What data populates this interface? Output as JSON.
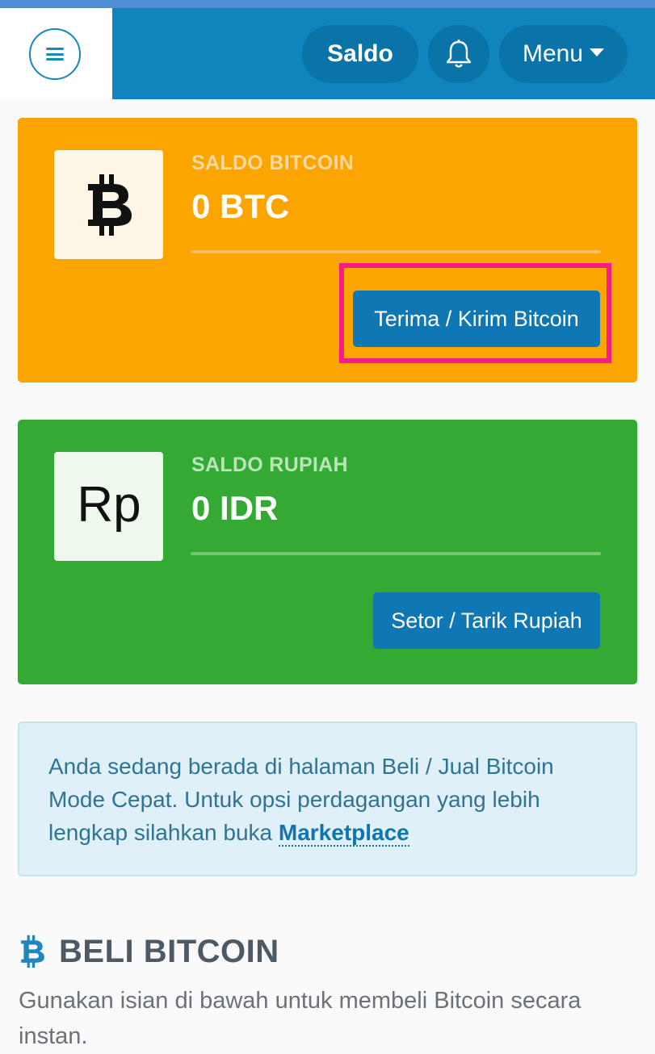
{
  "header": {
    "saldo_label": "Saldo",
    "menu_label": "Menu",
    "bell_icon": "bell-icon",
    "hamburger_icon": "hamburger-icon"
  },
  "cards": {
    "btc": {
      "label": "SALDO BITCOIN",
      "value": "0 BTC",
      "button": "Terima / Kirim Bitcoin",
      "color": "#fca500"
    },
    "idr": {
      "label": "SALDO RUPIAH",
      "value": "0 IDR",
      "icon_text": "Rp",
      "button": "Setor / Tarik Rupiah",
      "color": "#34aa35"
    }
  },
  "info": {
    "text": "Anda sedang berada di halaman Beli / Jual Bitcoin Mode Cepat. Untuk opsi perdagangan yang lebih lengkap silahkan buka",
    "link": "Marketplace"
  },
  "buy_section": {
    "title": "BELI BITCOIN",
    "description": "Gunakan isian di bawah untuk membeli Bitcoin secara instan."
  },
  "colors": {
    "header": "#0f84bd",
    "button": "#0f77b3",
    "highlight": "#f51c86"
  }
}
